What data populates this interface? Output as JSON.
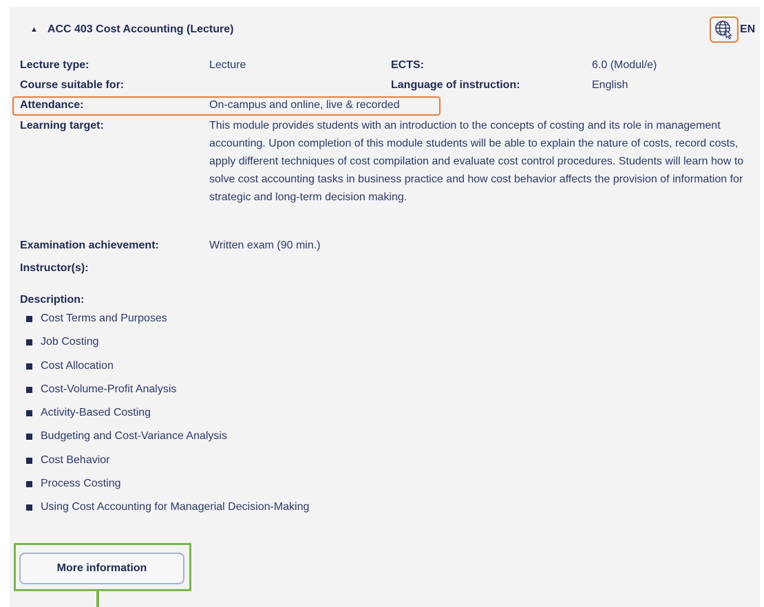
{
  "course": {
    "title": "ACC 403 Cost Accounting (Lecture)",
    "toggle_glyph": "▲",
    "language_code": "EN",
    "language_icon": "globe-cursor-icon"
  },
  "details": {
    "lecture_type": {
      "label": "Lecture type:",
      "value": "Lecture"
    },
    "ects": {
      "label": "ECTS:",
      "value": "6.0 (Modul/e)"
    },
    "suitable_for": {
      "label": "Course suitable for:",
      "value": ""
    },
    "language": {
      "label": "Language of instruction:",
      "value": "English"
    },
    "attendance": {
      "label": "Attendance:",
      "value": "On-campus and online, live & recorded"
    },
    "learning_target": {
      "label": "Learning target:",
      "value": "This module provides students with an introduction to the concepts of costing and its role in management accounting. Upon completion of this module students will be able to explain the nature of costs, record costs, apply different techniques of cost compilation and evaluate cost control procedures. Students will learn how to solve cost accounting tasks in business practice and how cost behavior affects the provision of information for strategic and long-term decision making."
    },
    "examination": {
      "label": "Examination achievement:",
      "value": "Written exam (90 min.)"
    },
    "instructors": {
      "label": "Instructor(s):",
      "value": ""
    }
  },
  "description": {
    "label": "Description:",
    "items": [
      "Cost Terms and Purposes",
      "Job Costing",
      "Cost Allocation",
      "Cost-Volume-Profit Analysis",
      "Activity-Based Costing",
      "Budgeting and Cost-Variance Analysis",
      "Cost Behavior",
      "Process Costing",
      "Using Cost Accounting for Managerial Decision-Making"
    ]
  },
  "actions": {
    "more_info_label": "More information"
  },
  "colors": {
    "highlight_orange": "#ee7d35",
    "highlight_green": "#7ab648",
    "text_navy": "#1f2a55",
    "panel_bg": "#f3f3f3"
  }
}
